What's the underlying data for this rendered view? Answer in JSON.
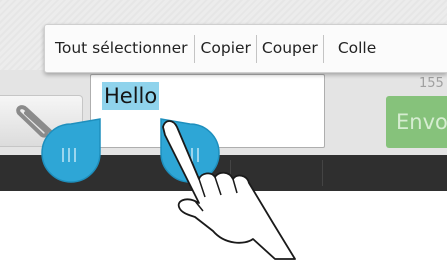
{
  "context_menu": {
    "select_all_label": "Tout sélectionner",
    "copy_label": "Copier",
    "cut_label": "Couper",
    "paste_label": "Colle"
  },
  "compose": {
    "message_text": "Hello",
    "char_counter": "155",
    "send_label": "Envo"
  },
  "icons": {
    "attach": "paperclip-icon",
    "left_handle": "selection-start-handle",
    "right_handle": "selection-end-handle",
    "hand": "pointing-hand-icon"
  },
  "colors": {
    "selection_highlight": "#8fd3ec",
    "handle_blue": "#2ea6d6",
    "send_green": "#86c27b",
    "dark_bar": "#2f2f2f"
  }
}
